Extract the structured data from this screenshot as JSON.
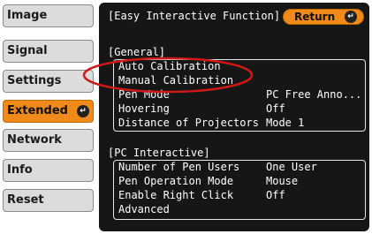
{
  "sidebar": {
    "items": [
      {
        "label": "Image"
      },
      {
        "label": "Signal"
      },
      {
        "label": "Settings"
      },
      {
        "label": "Extended",
        "active": true
      },
      {
        "label": "Network"
      },
      {
        "label": "Info"
      },
      {
        "label": "Reset"
      }
    ]
  },
  "header": {
    "title": "[Easy Interactive Function]",
    "return_label": "Return"
  },
  "sections": [
    {
      "heading": "[General]",
      "rows": [
        {
          "label": "Auto Calibration",
          "value": ""
        },
        {
          "label": "Manual Calibration",
          "value": ""
        },
        {
          "label": "Pen Mode",
          "value": "PC Free Anno..."
        },
        {
          "label": "Hovering",
          "value": "Off"
        },
        {
          "label": "Distance of Projectors",
          "value": "Mode 1"
        }
      ]
    },
    {
      "heading": "[PC Interactive]",
      "rows": [
        {
          "label": "Number of Pen Users",
          "value": "One User"
        },
        {
          "label": "Pen Operation Mode",
          "value": "Mouse"
        },
        {
          "label": "Enable Right Click",
          "value": "Off"
        },
        {
          "label": "Advanced",
          "value": ""
        }
      ]
    }
  ],
  "colors": {
    "accent": "#f08a1a",
    "panel": "#161616",
    "annotation": "#d01818"
  },
  "icons": {
    "enter": "enter-icon"
  }
}
